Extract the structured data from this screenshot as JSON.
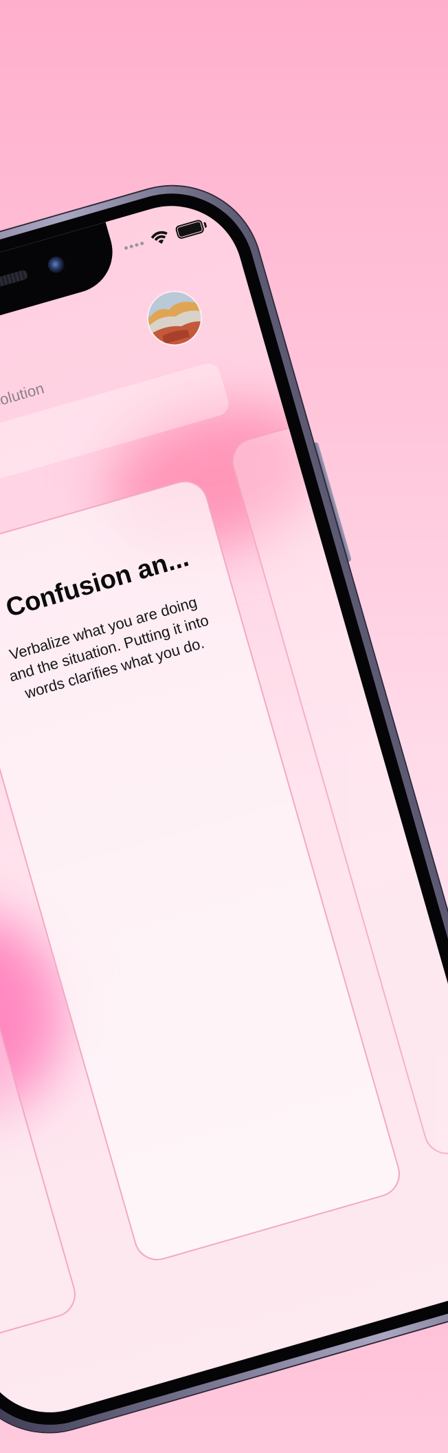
{
  "header": {
    "subtitle": "atured solution"
  },
  "card": {
    "title": "Confusion an...",
    "text": "Verbalize what you are doing and the situation. Putting it into words clarifies what you do."
  },
  "icons": {
    "wifi": "wifi-icon",
    "battery": "battery-icon",
    "avatar": "profile-avatar"
  },
  "colors": {
    "background": "#ffafcc",
    "card_border": "#f3a8c2",
    "accent_pink": "#ff82aa",
    "phone_frame": "#7b7894"
  }
}
